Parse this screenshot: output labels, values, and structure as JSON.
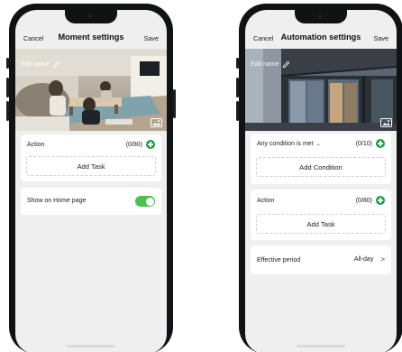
{
  "moment_screen": {
    "nav": {
      "cancel": "Cancel",
      "title": "Moment settings",
      "save": "Save"
    },
    "hero": {
      "edit_name": "Edit name"
    },
    "action": {
      "label": "Action",
      "count": "(0/80)",
      "add_task": "Add Task"
    },
    "show_home": {
      "label": "Show on Home page",
      "enabled": true
    }
  },
  "automation_screen": {
    "nav": {
      "cancel": "Cancel",
      "title": "Automation settings",
      "save": "Save"
    },
    "hero": {
      "edit_name": "Edit name"
    },
    "condition": {
      "label": "Any condition is met",
      "count": "(0/10)",
      "add_condition": "Add Condition"
    },
    "action": {
      "label": "Action",
      "count": "(0/80)",
      "add_task": "Add Task"
    },
    "effective_period": {
      "label": "Effective period",
      "value": "All-day"
    }
  },
  "colors": {
    "accent_green": "#1a9a4b",
    "toggle_on": "#4cc14f",
    "screen_bg": "#efefef"
  },
  "icons": [
    "pencil-icon",
    "image-icon",
    "add-icon",
    "chevron-down-icon",
    "chevron-right-icon"
  ]
}
